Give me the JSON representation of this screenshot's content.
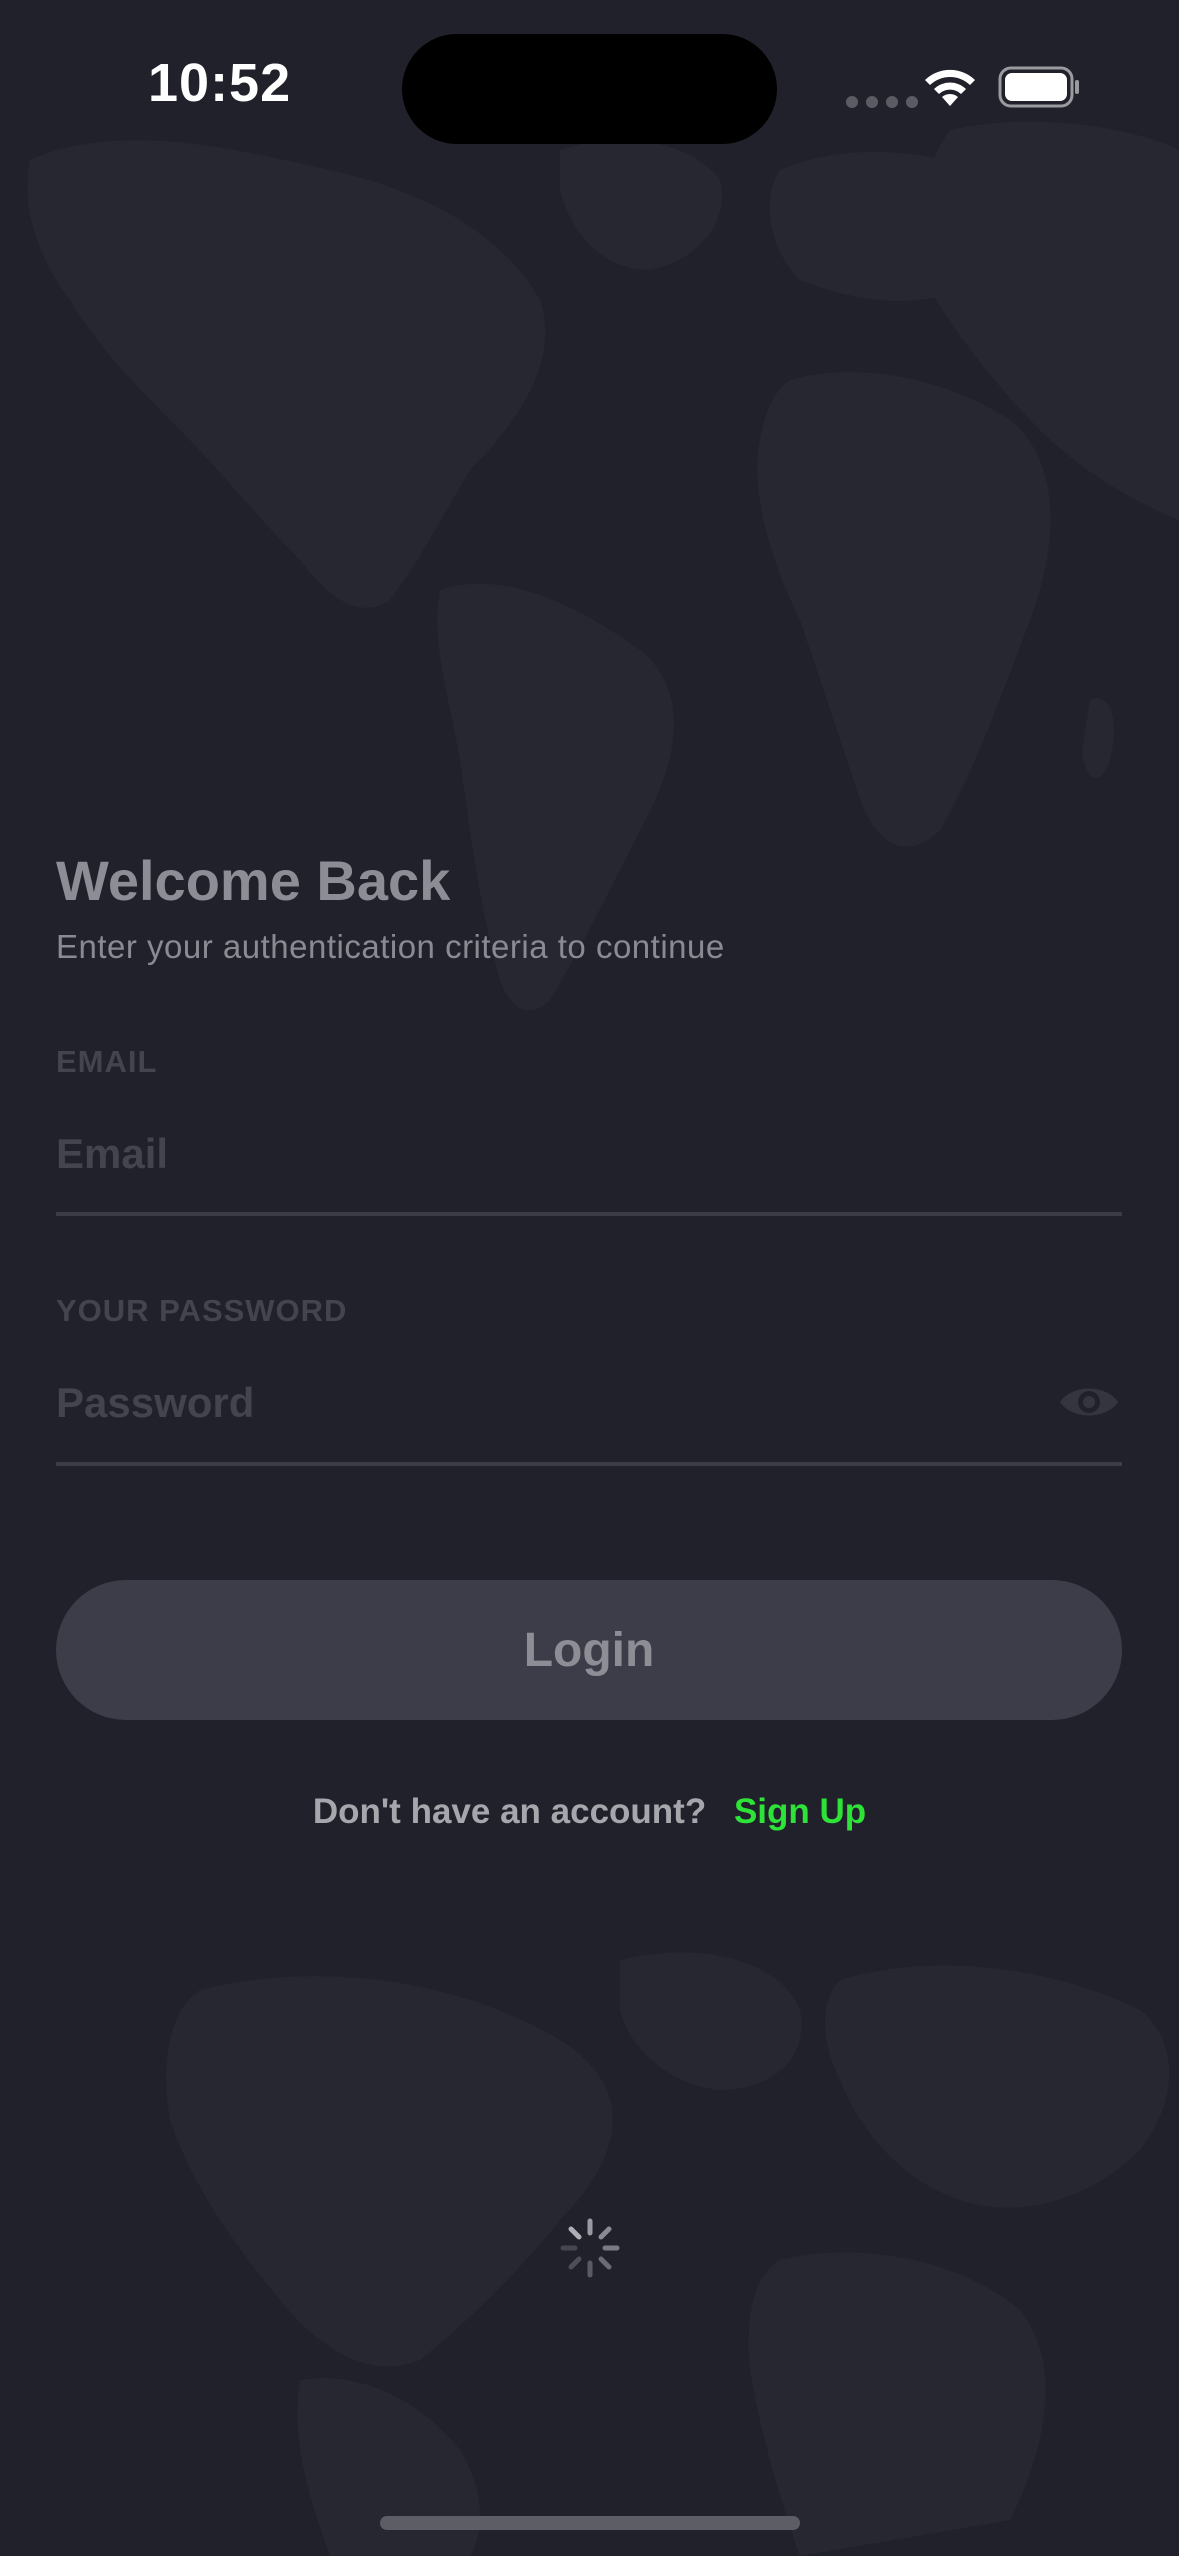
{
  "status_bar": {
    "time": "10:52",
    "icons": [
      "signal-dots-icon",
      "wifi-icon",
      "battery-icon"
    ]
  },
  "login": {
    "title": "Welcome Back",
    "subtitle": "Enter your authentication criteria to continue",
    "email_label": "EMAIL",
    "email_placeholder": "Email",
    "email_value": "",
    "password_label": "YOUR PASSWORD",
    "password_placeholder": "Password",
    "password_value": "",
    "password_toggle_icon": "eye-icon",
    "login_button": "Login",
    "signup_prompt": "Don't have an account?",
    "signup_link": "Sign Up"
  },
  "loading_indicator": "spinner-icon",
  "colors": {
    "background": "#20212a",
    "accent_green": "#2ee338",
    "button_bg": "#3c3d49",
    "muted_text": "#8d8e95"
  }
}
